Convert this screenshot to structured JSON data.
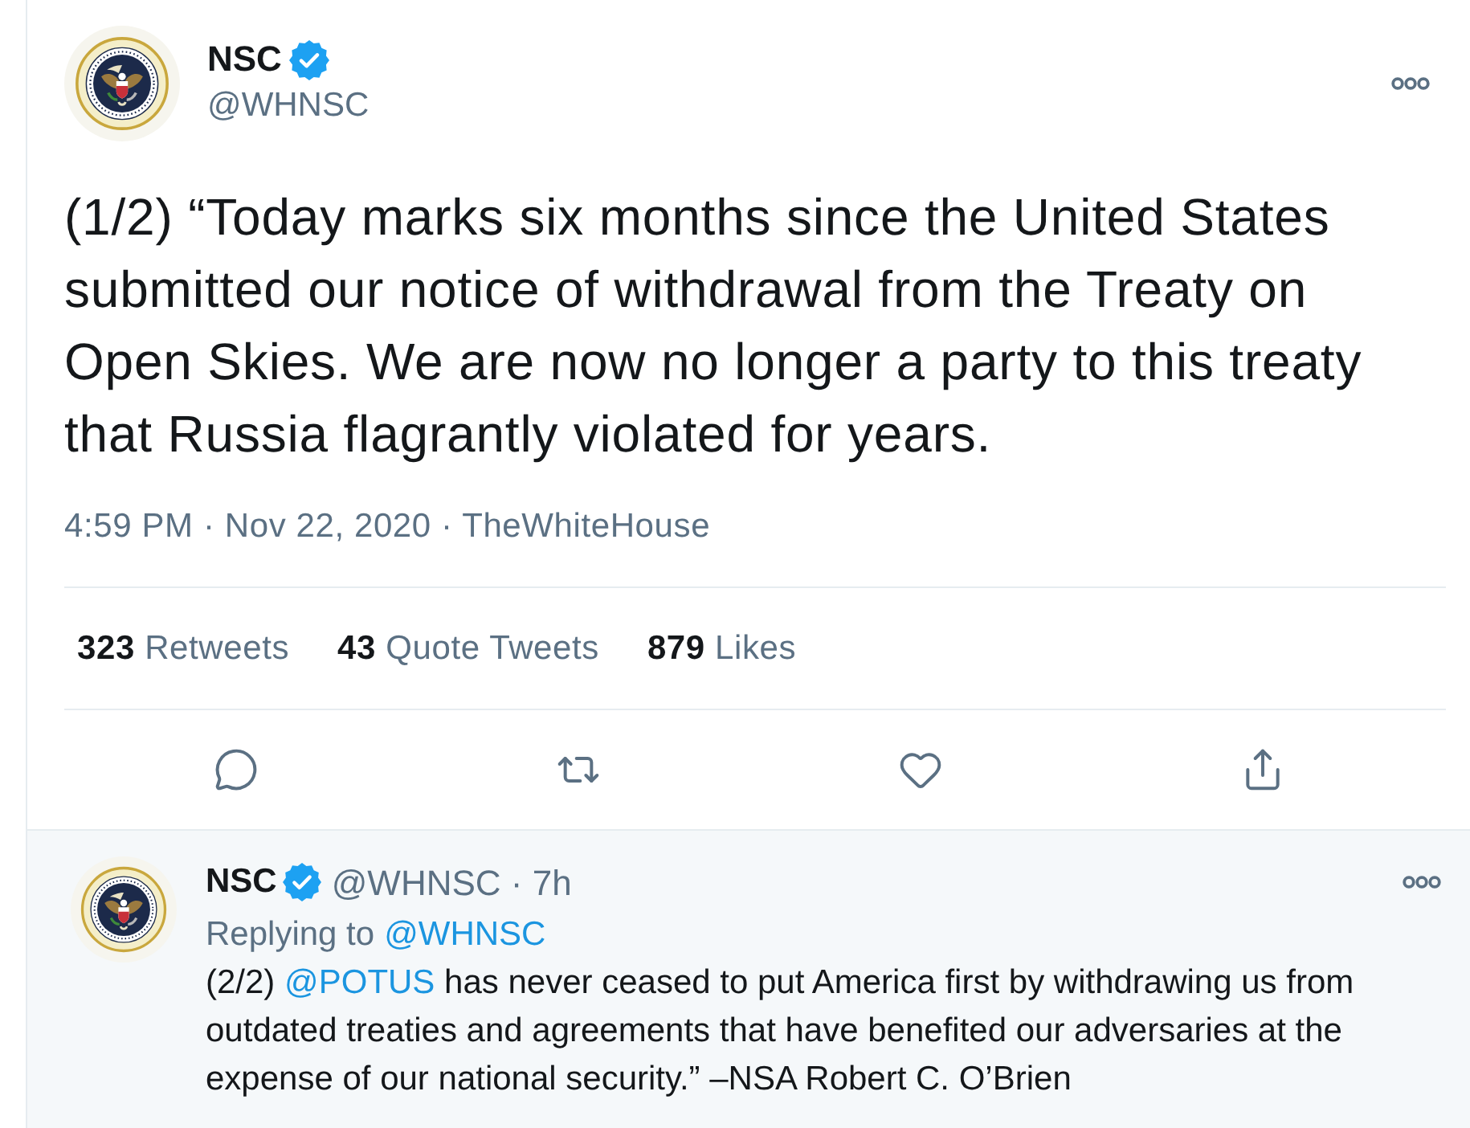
{
  "tweet": {
    "author": {
      "name": "NSC",
      "verified": true,
      "handle": "@WHNSC"
    },
    "text": "(1/2) “Today marks six months since the United States submitted our notice of withdrawal from the Treaty on Open Skies. We are now no longer a party to this treaty that Russia flagrantly violated for years.",
    "timestamp": "4:59 PM · Nov 22, 2020 · TheWhiteHouse",
    "stats": [
      {
        "count": "323",
        "label": "Retweets"
      },
      {
        "count": "43",
        "label": "Quote Tweets"
      },
      {
        "count": "879",
        "label": "Likes"
      }
    ],
    "actions": [
      {
        "kind": "reply"
      },
      {
        "kind": "retweet"
      },
      {
        "kind": "like"
      },
      {
        "kind": "share"
      }
    ]
  },
  "reply": {
    "author": {
      "name": "NSC",
      "verified": true,
      "meta": "@WHNSC · 7h"
    },
    "replying_to": {
      "label": "Replying to",
      "handle": "@WHNSC"
    },
    "text": [
      {
        "kind": "text",
        "text": "(2/2)"
      },
      {
        "kind": "mention",
        "text": "@POTUS"
      },
      {
        "kind": "text",
        "text": "has never ceased to put America first by withdrawing us from outdated treaties and agreements that have benefited our adversaries at the expense of our national security.” –NSA Robert C. O’Brien"
      }
    ]
  }
}
